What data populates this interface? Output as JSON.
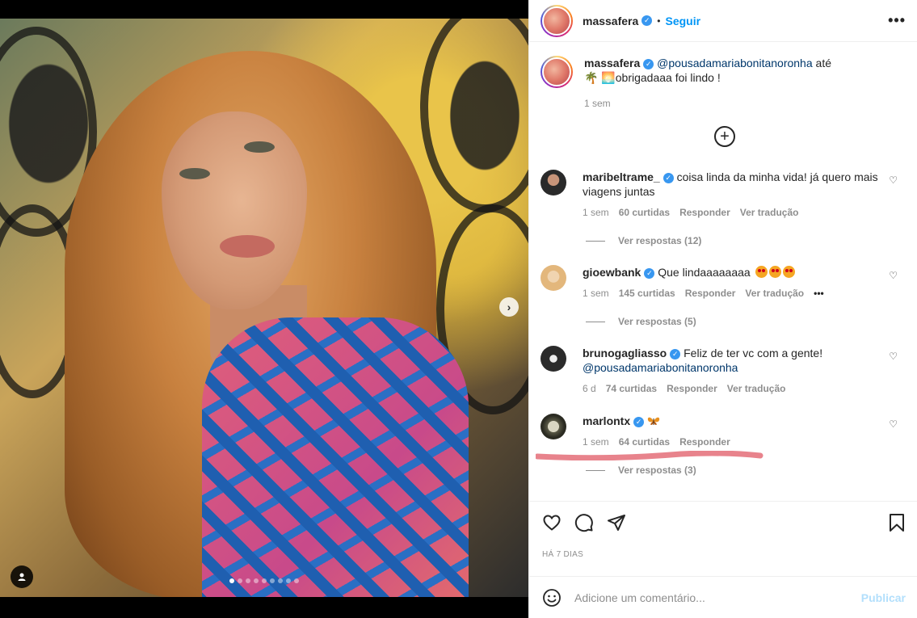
{
  "post": {
    "author": "massafera",
    "follow_label": "Seguir",
    "separator": "•",
    "more_label": "•••",
    "photo_dots": 9,
    "active_dot": 0
  },
  "caption": {
    "author": "massafera",
    "mention": "@pousadamariabonitanoronha",
    "text": " até 🌴 🌅obrigadaaa foi lindo !",
    "time": "1 sem"
  },
  "comments": [
    {
      "user": "maribeltrame_",
      "text": "coisa linda da minha vida! já quero mais viagens juntas",
      "time": "1 sem",
      "likes": "60 curtidas",
      "reply": "Responder",
      "translate": "Ver tradução",
      "replies": "Ver respostas (12)",
      "avatar_color": "#2a2a2a"
    },
    {
      "user": "gioewbank",
      "text": "Que lindaaaaaaaa",
      "time": "1 sem",
      "likes": "145 curtidas",
      "reply": "Responder",
      "translate": "Ver tradução",
      "more": "•••",
      "replies": "Ver respostas (5)",
      "avatar_color": "#e8c9a0"
    },
    {
      "user": "brunogagliasso",
      "text": "Feliz de ter vc com a gente!",
      "mention": "@pousadamariabonitanoronha",
      "time": "6 d",
      "likes": "74 curtidas",
      "reply": "Responder",
      "translate": "Ver tradução",
      "avatar_color": "#3a3a3a"
    },
    {
      "user": "marlontx",
      "text": "",
      "time": "1 sem",
      "likes": "64 curtidas",
      "reply": "Responder",
      "replies": "Ver respostas (3)",
      "avatar_color": "#6b6a55"
    }
  ],
  "footer": {
    "date": "HÁ 7 DIAS",
    "comment_placeholder": "Adicione um comentário...",
    "publish_label": "Publicar"
  },
  "colors": {
    "accent": "#0095f6",
    "verified": "#3897f0",
    "muted": "#8e8e8e",
    "highlight_line": "#e8838c"
  },
  "icons": [
    "heart-icon",
    "comment-icon",
    "share-icon",
    "bookmark-icon",
    "emoji-icon",
    "plus-circle-icon",
    "tag-user-icon",
    "chevron-right-icon"
  ]
}
